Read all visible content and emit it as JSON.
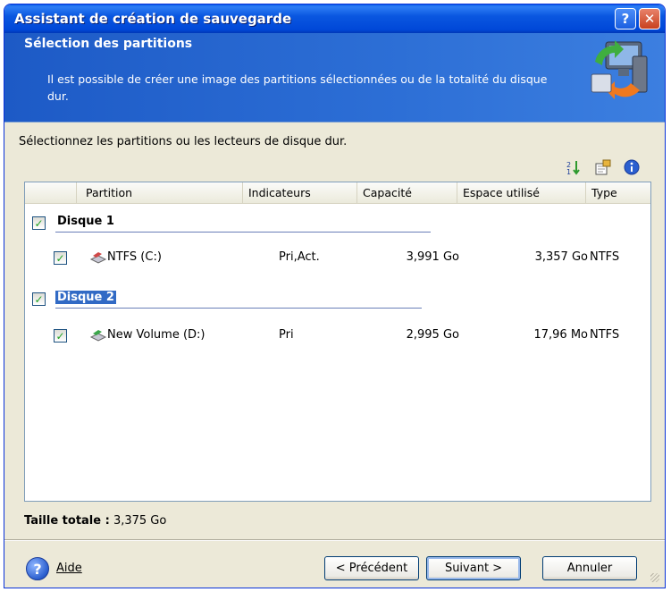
{
  "window": {
    "title": "Assistant de création de sauvegarde",
    "help_btn": "?",
    "close_btn": "✕"
  },
  "header": {
    "title": "Sélection des partitions",
    "description": "Il est possible de créer une image des partitions sélectionnées ou de la totalité du disque dur.",
    "icon": "backup-computer-icon"
  },
  "prompt": "Sélectionnez les partitions ou les lecteurs de disque dur.",
  "toolbar_icons": [
    "sort-icon",
    "properties-icon",
    "info-icon"
  ],
  "table": {
    "columns": [
      "Partition",
      "Indicateurs",
      "Capacité",
      "Espace utilisé",
      "Type"
    ],
    "disks": [
      {
        "label": "Disque 1",
        "checked": true,
        "selected": false,
        "partitions": [
          {
            "name": "NTFS (C:)",
            "flags": "Pri,Act.",
            "capacity": "3,991 Go",
            "used": "3,357 Go",
            "type": "NTFS",
            "checked": true
          }
        ]
      },
      {
        "label": "Disque 2",
        "checked": true,
        "selected": true,
        "partitions": [
          {
            "name": "New Volume (D:)",
            "flags": "Pri",
            "capacity": "2,995 Go",
            "used": "17,96 Mo",
            "type": "NTFS",
            "checked": true
          }
        ]
      }
    ]
  },
  "total": {
    "label": "Taille totale :",
    "value": "3,375 Go"
  },
  "footer": {
    "help_label": "Aide",
    "prev_label": "< Précédent",
    "next_label": "Suivant >",
    "cancel_label": "Annuler"
  },
  "colors": {
    "titlebar": "#0a57e0",
    "header": "#2d6fd6",
    "dialog_bg": "#ece9d8",
    "selection": "#316ac5",
    "check": "#21a121"
  }
}
